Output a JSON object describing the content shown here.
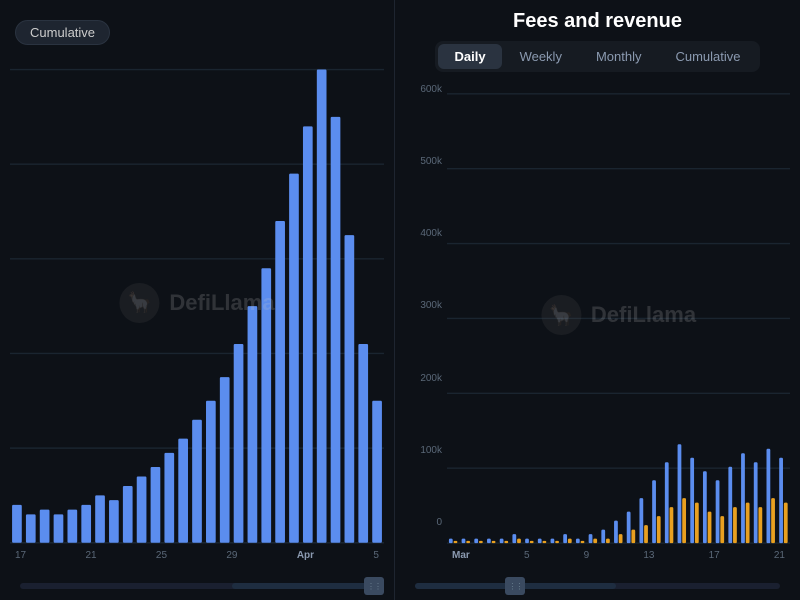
{
  "leftChart": {
    "title": "",
    "tabs": [
      "Cumulative"
    ],
    "activeTab": "Cumulative",
    "yLabels": [],
    "xLabels": [
      "17",
      "21",
      "25",
      "29",
      "Apr",
      "5"
    ],
    "aprLabel": "Apr",
    "watermark": "DefiLlama",
    "bars": [
      {
        "x": 0,
        "height": 0.08,
        "color": "#5b8def"
      },
      {
        "x": 1,
        "height": 0.06,
        "color": "#5b8def"
      },
      {
        "x": 2,
        "height": 0.07,
        "color": "#5b8def"
      },
      {
        "x": 3,
        "height": 0.06,
        "color": "#5b8def"
      },
      {
        "x": 4,
        "height": 0.07,
        "color": "#5b8def"
      },
      {
        "x": 5,
        "height": 0.08,
        "color": "#5b8def"
      },
      {
        "x": 6,
        "height": 0.1,
        "color": "#5b8def"
      },
      {
        "x": 7,
        "height": 0.09,
        "color": "#5b8def"
      },
      {
        "x": 8,
        "height": 0.12,
        "color": "#5b8def"
      },
      {
        "x": 9,
        "height": 0.14,
        "color": "#5b8def"
      },
      {
        "x": 10,
        "height": 0.16,
        "color": "#5b8def"
      },
      {
        "x": 11,
        "height": 0.19,
        "color": "#5b8def"
      },
      {
        "x": 12,
        "height": 0.22,
        "color": "#5b8def"
      },
      {
        "x": 13,
        "height": 0.26,
        "color": "#5b8def"
      },
      {
        "x": 14,
        "height": 0.3,
        "color": "#5b8def"
      },
      {
        "x": 15,
        "height": 0.35,
        "color": "#5b8def"
      },
      {
        "x": 16,
        "height": 0.42,
        "color": "#5b8def"
      },
      {
        "x": 17,
        "height": 0.5,
        "color": "#5b8def"
      },
      {
        "x": 18,
        "height": 0.58,
        "color": "#5b8def"
      },
      {
        "x": 19,
        "height": 0.68,
        "color": "#5b8def"
      },
      {
        "x": 20,
        "height": 0.78,
        "color": "#5b8def"
      },
      {
        "x": 21,
        "height": 0.88,
        "color": "#5b8def"
      },
      {
        "x": 22,
        "height": 1.0,
        "color": "#5b8def"
      },
      {
        "x": 23,
        "height": 0.9,
        "color": "#5b8def"
      },
      {
        "x": 24,
        "height": 0.65,
        "color": "#5b8def"
      },
      {
        "x": 25,
        "height": 0.42,
        "color": "#5b8def"
      },
      {
        "x": 26,
        "height": 0.3,
        "color": "#5b8def"
      }
    ],
    "scrollbar": {
      "thumbLeft": "60%",
      "thumbWidth": "40%",
      "handleRight": "0%"
    }
  },
  "rightChart": {
    "title": "Fees and revenue",
    "tabs": [
      "Daily",
      "Weekly",
      "Monthly",
      "Cumulative"
    ],
    "activeTab": "Daily",
    "yLabels": [
      "0",
      "100k",
      "200k",
      "300k",
      "400k",
      "500k",
      "600k"
    ],
    "xLabels": [
      "Mar",
      "5",
      "9",
      "13",
      "17",
      "21"
    ],
    "marLabel": "Mar",
    "watermark": "DefiLlama",
    "bars": [
      {
        "height": 0.01,
        "color": "#5b8def",
        "height2": 0.005,
        "color2": "#e8a020"
      },
      {
        "height": 0.01,
        "color": "#5b8def",
        "height2": 0.005,
        "color2": "#e8a020"
      },
      {
        "height": 0.01,
        "color": "#5b8def",
        "height2": 0.005,
        "color2": "#e8a020"
      },
      {
        "height": 0.01,
        "color": "#5b8def",
        "height2": 0.005,
        "color2": "#e8a020"
      },
      {
        "height": 0.01,
        "color": "#5b8def",
        "height2": 0.005,
        "color2": "#e8a020"
      },
      {
        "height": 0.02,
        "color": "#5b8def",
        "height2": 0.01,
        "color2": "#e8a020"
      },
      {
        "height": 0.01,
        "color": "#5b8def",
        "height2": 0.005,
        "color2": "#e8a020"
      },
      {
        "height": 0.01,
        "color": "#5b8def",
        "height2": 0.005,
        "color2": "#e8a020"
      },
      {
        "height": 0.01,
        "color": "#5b8def",
        "height2": 0.005,
        "color2": "#e8a020"
      },
      {
        "height": 0.02,
        "color": "#5b8def",
        "height2": 0.01,
        "color2": "#e8a020"
      },
      {
        "height": 0.01,
        "color": "#5b8def",
        "height2": 0.005,
        "color2": "#e8a020"
      },
      {
        "height": 0.02,
        "color": "#5b8def",
        "height2": 0.01,
        "color2": "#e8a020"
      },
      {
        "height": 0.03,
        "color": "#5b8def",
        "height2": 0.01,
        "color2": "#e8a020"
      },
      {
        "height": 0.05,
        "color": "#5b8def",
        "height2": 0.02,
        "color2": "#e8a020"
      },
      {
        "height": 0.07,
        "color": "#5b8def",
        "height2": 0.03,
        "color2": "#e8a020"
      },
      {
        "height": 0.1,
        "color": "#5b8def",
        "height2": 0.04,
        "color2": "#e8a020"
      },
      {
        "height": 0.14,
        "color": "#5b8def",
        "height2": 0.06,
        "color2": "#e8a020"
      },
      {
        "height": 0.18,
        "color": "#5b8def",
        "height2": 0.08,
        "color2": "#e8a020"
      },
      {
        "height": 0.22,
        "color": "#5b8def",
        "height2": 0.1,
        "color2": "#e8a020"
      },
      {
        "height": 0.19,
        "color": "#5b8def",
        "height2": 0.09,
        "color2": "#e8a020"
      },
      {
        "height": 0.16,
        "color": "#5b8def",
        "height2": 0.07,
        "color2": "#e8a020"
      },
      {
        "height": 0.14,
        "color": "#5b8def",
        "height2": 0.06,
        "color2": "#e8a020"
      },
      {
        "height": 0.17,
        "color": "#5b8def",
        "height2": 0.08,
        "color2": "#e8a020"
      },
      {
        "height": 0.2,
        "color": "#5b8def",
        "height2": 0.09,
        "color2": "#e8a020"
      },
      {
        "height": 0.18,
        "color": "#5b8def",
        "height2": 0.08,
        "color2": "#e8a020"
      },
      {
        "height": 0.21,
        "color": "#5b8def",
        "height2": 0.1,
        "color2": "#e8a020"
      },
      {
        "height": 0.19,
        "color": "#5b8def",
        "height2": 0.09,
        "color2": "#e8a020"
      }
    ],
    "scrollbar": {
      "thumbLeft": "0%",
      "thumbWidth": "55%",
      "handleRight": "55%"
    }
  }
}
